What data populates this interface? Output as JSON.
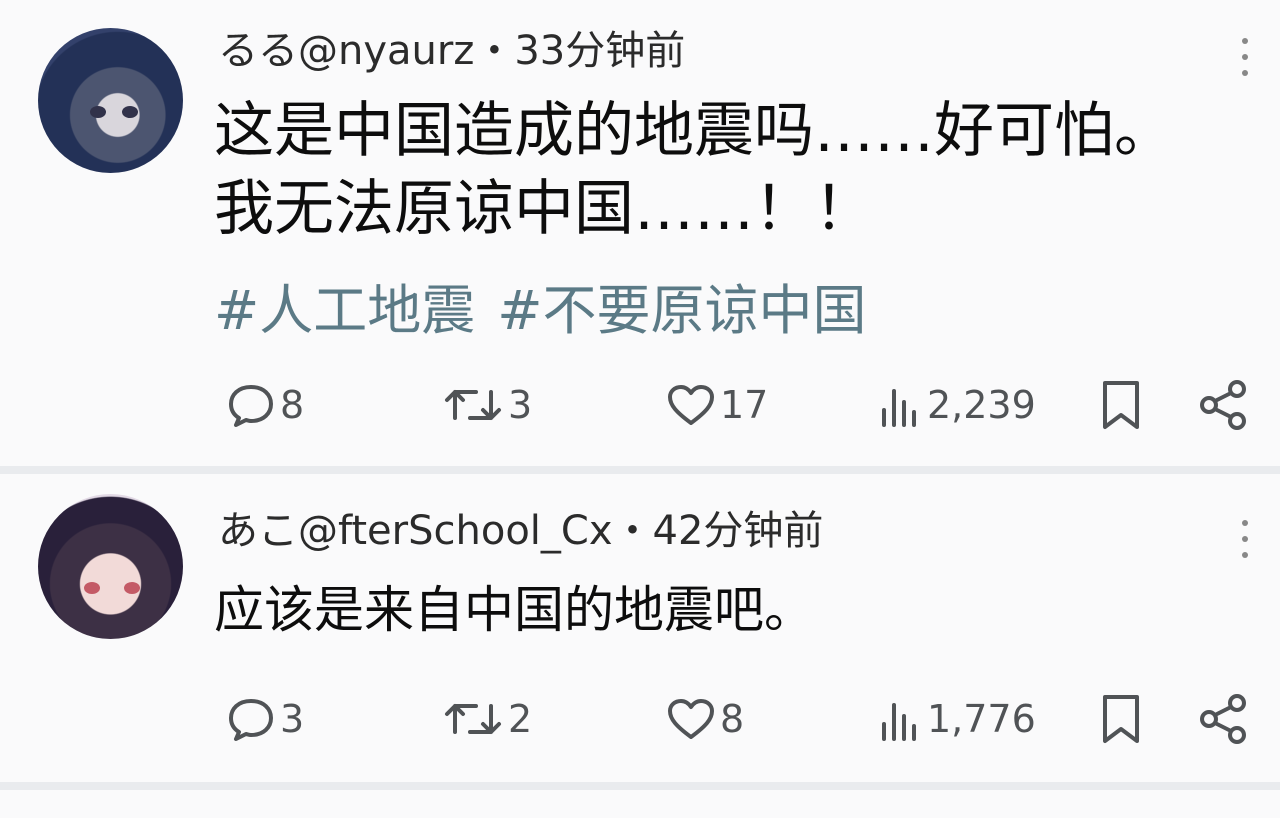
{
  "posts": [
    {
      "header": "るる@nyaurz・33分钟前",
      "text": "这是中国造成的地震吗……好可怕。我无法原谅中国……！！",
      "tags": [
        "#人工地震",
        "#不要原谅中国"
      ],
      "replies": "8",
      "reposts": "3",
      "likes": "17",
      "views": "2,239"
    },
    {
      "header": "あこ@fterSchool_Cx・42分钟前",
      "text": "应该是来自中国的地震吧。",
      "replies": "3",
      "reposts": "2",
      "likes": "8",
      "views": "1,776"
    }
  ],
  "icons": {
    "reply": "speech-bubble-icon",
    "repost": "repost-arrows-icon",
    "like": "heart-icon",
    "views": "bar-chart-icon",
    "bookmark": "bookmark-icon",
    "share": "share-icon",
    "more": "more-vertical-icon"
  },
  "colors": {
    "text": "#0d0d0d",
    "muted": "#505356",
    "hashtag": "#5b7a86",
    "background": "#fafafb"
  }
}
